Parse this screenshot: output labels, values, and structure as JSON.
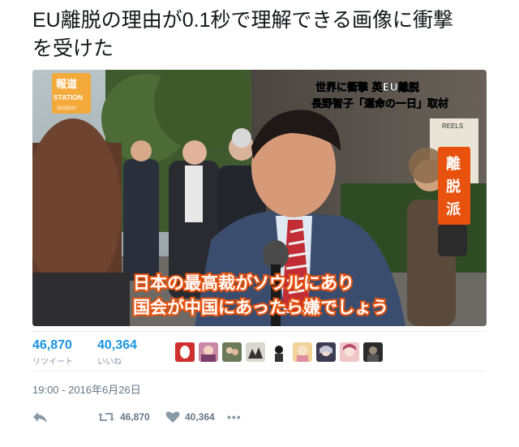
{
  "tweet": {
    "text": "EU離脱の理由が0.1秒で理解できる画像に衝撃\nを受けた"
  },
  "media": {
    "show_logo_top": "報道",
    "show_logo_mid": "STATION",
    "show_logo_bot": "SUNDAY",
    "headline_line1": "世界に衝撃 英EU離脱",
    "headline_line2": "長野智子「運命の一日」取材",
    "vertical_badge": [
      "離",
      "脱",
      "派"
    ],
    "storefront_sign": "REELS",
    "subtitle_line1": "日本の最高裁がソウルにあり",
    "subtitle_line2": "国会が中国にあったら嫌でしょう"
  },
  "stats": {
    "retweets_count": "46,870",
    "retweets_label": "リツイート",
    "likes_count": "40,364",
    "likes_label": "いいね"
  },
  "timestamp": "19:00 - 2016年6月26日",
  "actions": {
    "retweet_count": "46,870",
    "like_count": "40,364",
    "more_label": "•••"
  },
  "colors": {
    "link_blue": "#1b95e0",
    "muted_gray": "#657786",
    "subtitle_fill": "#ffffff",
    "subtitle_stroke": "#e8520e",
    "badge_bg": "#e8520e"
  },
  "icons": [
    "reply-icon",
    "retweet-icon",
    "heart-icon",
    "more-icon"
  ]
}
